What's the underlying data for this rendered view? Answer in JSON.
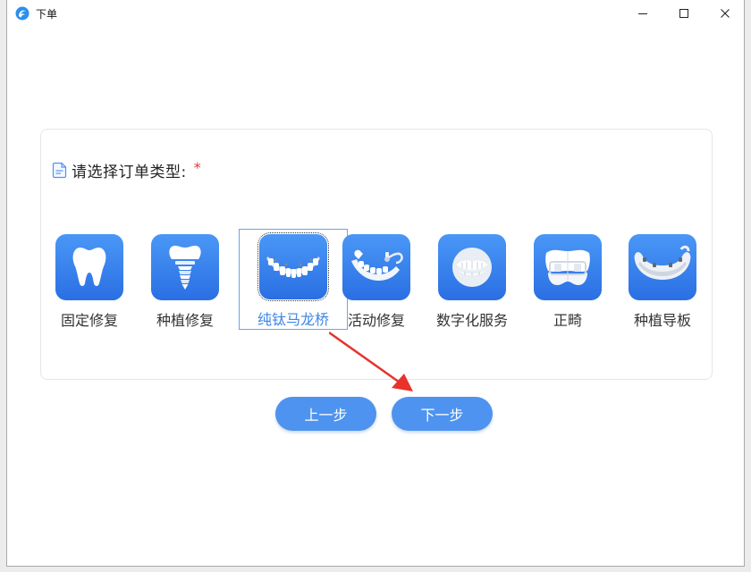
{
  "window": {
    "title": "下单",
    "controls": {
      "minimize": "minimize-icon",
      "maximize": "maximize-icon",
      "close": "close-icon"
    }
  },
  "prompt": {
    "label": "请选择订单类型:",
    "required_mark": "*"
  },
  "order_types": [
    {
      "label": "固定修复",
      "icon": "tooth-icon"
    },
    {
      "label": "种植修复",
      "icon": "implant-icon"
    },
    {
      "label": "纯钛马龙桥",
      "icon": "titanium-bridge-icon",
      "selected": true
    },
    {
      "label": "活动修复",
      "icon": "removable-denture-icon"
    },
    {
      "label": "数字化服务",
      "icon": "digital-smile-icon"
    },
    {
      "label": "正畸",
      "icon": "orthodontic-brace-icon"
    },
    {
      "label": "种植导板",
      "icon": "implant-guide-icon"
    }
  ],
  "buttons": {
    "prev": "上一步",
    "next": "下一步"
  },
  "colors": {
    "accent": "#4e93ef",
    "tile": "#3a84ee",
    "selected_text": "#3c86e6",
    "required": "#e0373a",
    "annotation_arrow": "#e8322c"
  }
}
